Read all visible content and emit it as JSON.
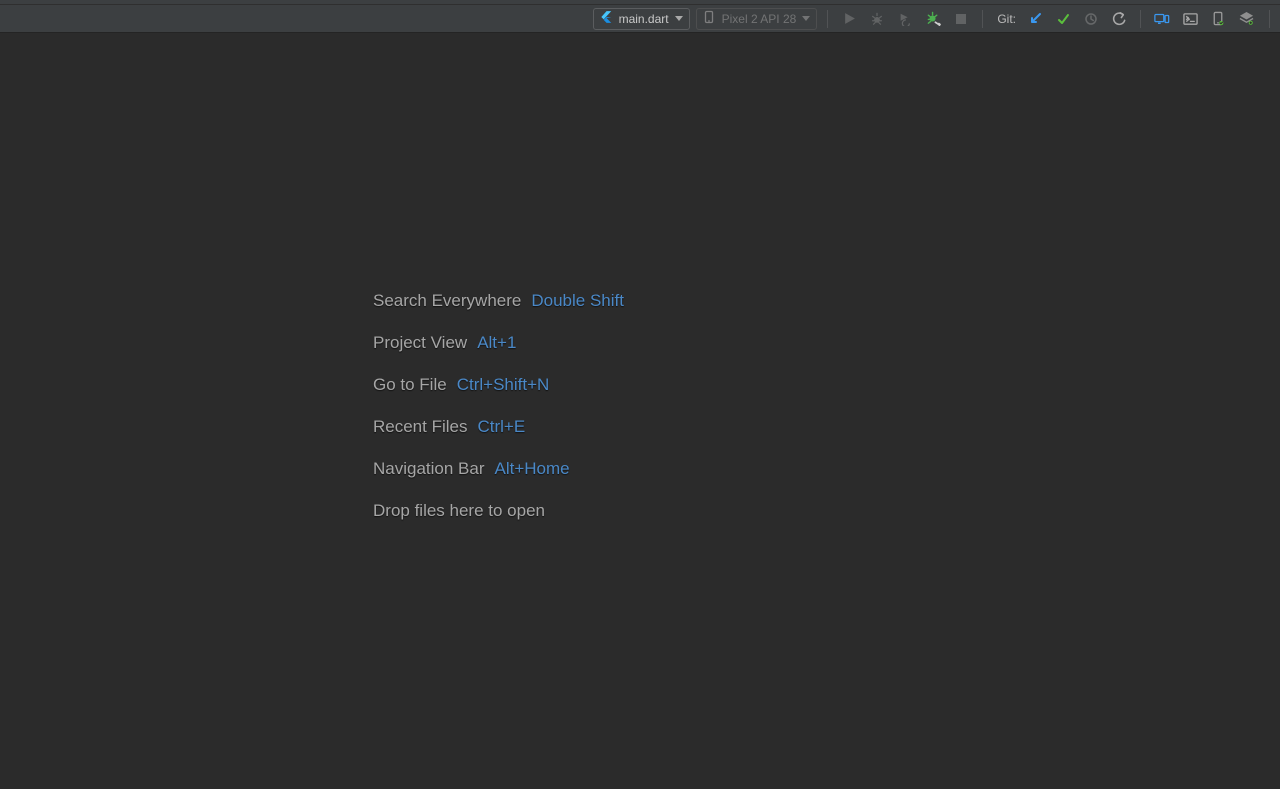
{
  "toolbar": {
    "run_config": {
      "label": "main.dart"
    },
    "device": {
      "label": "Pixel 2 API 28"
    },
    "git_label": "Git:"
  },
  "welcome": {
    "rows": [
      {
        "label": "Search Everywhere",
        "shortcut": "Double Shift"
      },
      {
        "label": "Project View",
        "shortcut": "Alt+1"
      },
      {
        "label": "Go to File",
        "shortcut": "Ctrl+Shift+N"
      },
      {
        "label": "Recent Files",
        "shortcut": "Ctrl+E"
      },
      {
        "label": "Navigation Bar",
        "shortcut": "Alt+Home"
      }
    ],
    "drop_hint": "Drop files here to open"
  }
}
